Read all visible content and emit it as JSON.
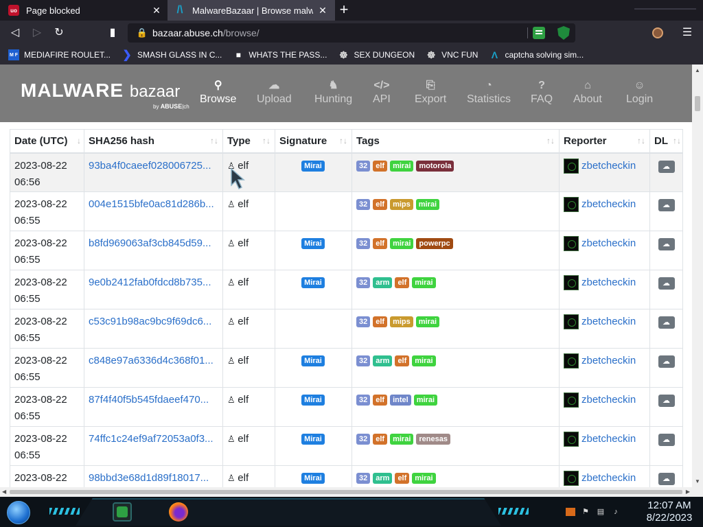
{
  "tabs": [
    {
      "title": "Page blocked",
      "favicon": "uo"
    },
    {
      "title": "MalwareBazaar | Browse malware s",
      "favicon": "/\\"
    }
  ],
  "nav": {
    "url_host": "bazaar.abuse.ch",
    "url_path": "/browse/"
  },
  "bookmarks": [
    {
      "label": "MEDIAFIRE ROULET...",
      "icon": "M F"
    },
    {
      "label": "SMASH GLASS IN C...",
      "icon": "❯"
    },
    {
      "label": "WHATS THE PASS...",
      "icon": "■"
    },
    {
      "label": "SEX DUNGEON",
      "icon": "☸"
    },
    {
      "label": "VNC FUN",
      "icon": "☸"
    },
    {
      "label": "captcha solving sim...",
      "icon": "Λ"
    }
  ],
  "site": {
    "logo_main": "MALWARE",
    "logo_bazaar": "bazaar",
    "logo_by": "by",
    "logo_abuse": "ABUSE",
    "logo_ch": "ch",
    "nav_items": [
      {
        "label": "Browse",
        "icon": "search-icon",
        "glyph": "⚲",
        "active": true
      },
      {
        "label": "Upload",
        "icon": "cloud-upload-icon",
        "glyph": "☁",
        "active": false
      },
      {
        "label": "Hunting",
        "icon": "horse-icon",
        "glyph": "♞",
        "active": false
      },
      {
        "label": "API",
        "icon": "code-icon",
        "glyph": "</>",
        "active": false
      },
      {
        "label": "Export",
        "icon": "export-icon",
        "glyph": "⎘",
        "active": false
      },
      {
        "label": "Statistics",
        "icon": "pie-chart-icon",
        "glyph": "◔",
        "active": false
      },
      {
        "label": "FAQ",
        "icon": "question-icon",
        "glyph": "?",
        "active": false
      },
      {
        "label": "About",
        "icon": "bank-icon",
        "glyph": "⌂",
        "active": false
      },
      {
        "label": "Login",
        "icon": "user-icon",
        "glyph": "☺",
        "active": false
      }
    ]
  },
  "table": {
    "columns": [
      "Date (UTC)",
      "SHA256 hash",
      "Type",
      "Signature",
      "Tags",
      "Reporter",
      "DL"
    ],
    "rows": [
      {
        "date": "2023-08-22",
        "time": "06:56",
        "hash": "93ba4f0caeef028006725...",
        "type": "elf",
        "signature": "Mirai",
        "tags": [
          "32",
          "elf",
          "mirai",
          "motorola"
        ],
        "reporter": "zbetcheckin"
      },
      {
        "date": "2023-08-22",
        "time": "06:55",
        "hash": "004e1515bfe0ac81d286b...",
        "type": "elf",
        "signature": "",
        "tags": [
          "32",
          "elf",
          "mips",
          "mirai"
        ],
        "reporter": "zbetcheckin"
      },
      {
        "date": "2023-08-22",
        "time": "06:55",
        "hash": "b8fd969063af3cb845d59...",
        "type": "elf",
        "signature": "Mirai",
        "tags": [
          "32",
          "elf",
          "mirai",
          "powerpc"
        ],
        "reporter": "zbetcheckin"
      },
      {
        "date": "2023-08-22",
        "time": "06:55",
        "hash": "9e0b2412fab0fdcd8b735...",
        "type": "elf",
        "signature": "Mirai",
        "tags": [
          "32",
          "arm",
          "elf",
          "mirai"
        ],
        "reporter": "zbetcheckin"
      },
      {
        "date": "2023-08-22",
        "time": "06:55",
        "hash": "c53c91b98ac9bc9f69dc6...",
        "type": "elf",
        "signature": "",
        "tags": [
          "32",
          "elf",
          "mips",
          "mirai"
        ],
        "reporter": "zbetcheckin"
      },
      {
        "date": "2023-08-22",
        "time": "06:55",
        "hash": "c848e97a6336d4c368f01...",
        "type": "elf",
        "signature": "Mirai",
        "tags": [
          "32",
          "arm",
          "elf",
          "mirai"
        ],
        "reporter": "zbetcheckin"
      },
      {
        "date": "2023-08-22",
        "time": "06:55",
        "hash": "87f4f40f5b545fdaeef470...",
        "type": "elf",
        "signature": "Mirai",
        "tags": [
          "32",
          "elf",
          "intel",
          "mirai"
        ],
        "reporter": "zbetcheckin"
      },
      {
        "date": "2023-08-22",
        "time": "06:55",
        "hash": "74ffc1c24ef9af72053a0f3...",
        "type": "elf",
        "signature": "Mirai",
        "tags": [
          "32",
          "elf",
          "mirai",
          "renesas"
        ],
        "reporter": "zbetcheckin"
      },
      {
        "date": "2023-08-22",
        "time": "",
        "hash": "98bbd3e68d1d89f18017...",
        "type": "elf",
        "signature": "Mirai",
        "tags": [
          "32",
          "arm",
          "elf",
          "mirai"
        ],
        "reporter": "zbetcheckin"
      }
    ]
  },
  "tag_colors": {
    "32": "#7b8fd1",
    "elf": "#d2722a",
    "mirai": "#3fd33f",
    "motorola": "#7a2f3b",
    "mips": "#c99a2e",
    "powerpc": "#a04a12",
    "arm": "#2fbf8f",
    "intel": "#6f86c9",
    "renesas": "#a08a88"
  },
  "signature_color": "#1e7fe0",
  "taskbar": {
    "time": "12:07 AM",
    "date": "8/22/2023"
  }
}
